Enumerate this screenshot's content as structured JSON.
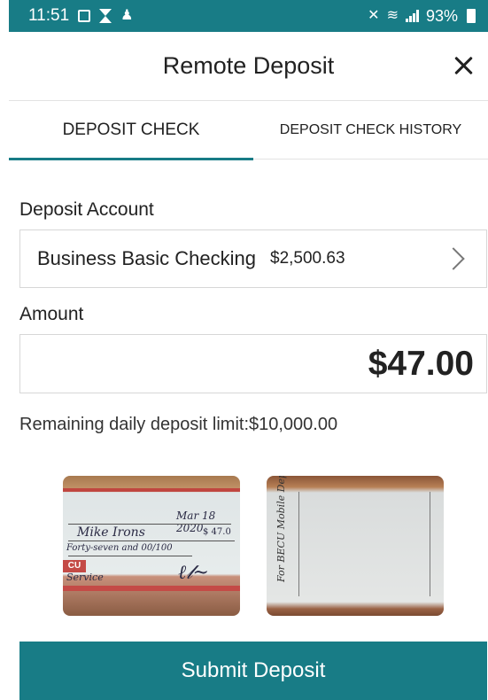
{
  "status_bar": {
    "time": "11:51",
    "battery_percent": "93%"
  },
  "header": {
    "title": "Remote Deposit"
  },
  "tabs": [
    {
      "label": "DEPOSIT CHECK",
      "active": true
    },
    {
      "label": "DEPOSIT CHECK HISTORY",
      "active": false
    }
  ],
  "deposit_account": {
    "label": "Deposit Account",
    "account_name": "Business Basic Checking",
    "balance": "$2,500.63"
  },
  "amount": {
    "label": "Amount",
    "value": "$47.00"
  },
  "remaining_limit_text": "Remaining daily deposit limit:$10,000.00",
  "check_front": {
    "date": "Mar 18 2020",
    "payee": "Mike Irons",
    "amount_words": "Forty-seven and 00/100",
    "amount_number": "$ 47.0",
    "memo": "Service",
    "bank_logo": "CU"
  },
  "check_back": {
    "endorsement": "For BECU Mobile Deposit Only"
  },
  "submit_button": {
    "label": "Submit Deposit"
  },
  "colors": {
    "primary": "#187c86",
    "divider": "#e3e3e3",
    "border": "#d7d7d7"
  }
}
